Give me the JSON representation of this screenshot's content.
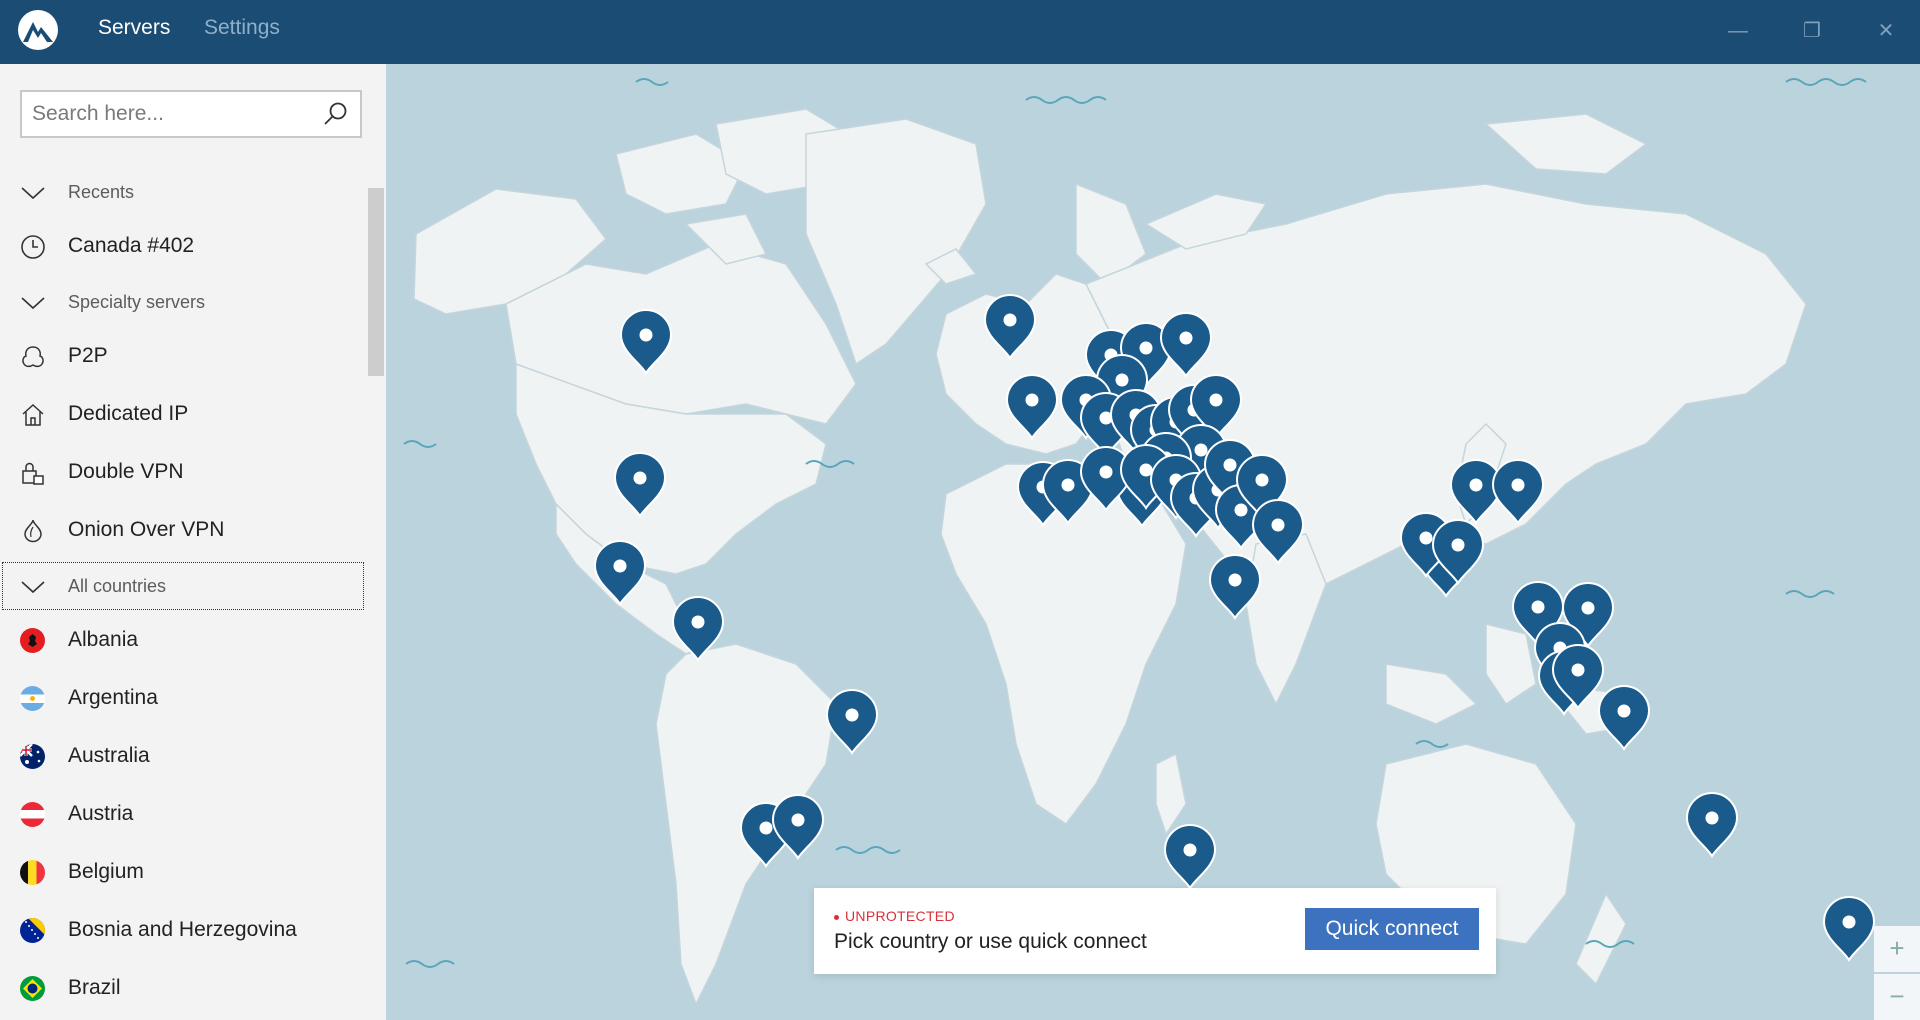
{
  "titlebar": {
    "tabs": [
      {
        "label": "Servers",
        "active": true
      },
      {
        "label": "Settings",
        "active": false
      }
    ],
    "minimize_glyph": "—",
    "restore_glyph": "❐",
    "close_glyph": "✕"
  },
  "search": {
    "placeholder": "Search here..."
  },
  "sidebar": {
    "recents_label": "Recents",
    "recent_item": "Canada #402",
    "specialty_label": "Specialty servers",
    "specialty": [
      {
        "label": "P2P",
        "icon": "p2p-icon"
      },
      {
        "label": "Dedicated IP",
        "icon": "home-icon"
      },
      {
        "label": "Double VPN",
        "icon": "double-lock-icon"
      },
      {
        "label": "Onion Over VPN",
        "icon": "onion-icon"
      }
    ],
    "all_countries_label": "All countries",
    "countries": [
      {
        "label": "Albania",
        "flag": "albania"
      },
      {
        "label": "Argentina",
        "flag": "argentina"
      },
      {
        "label": "Australia",
        "flag": "australia"
      },
      {
        "label": "Austria",
        "flag": "austria"
      },
      {
        "label": "Belgium",
        "flag": "belgium"
      },
      {
        "label": "Bosnia and Herzegovina",
        "flag": "bosnia"
      },
      {
        "label": "Brazil",
        "flag": "brazil"
      }
    ]
  },
  "status": {
    "state": "UNPROTECTED",
    "message": "Pick country or use quick connect",
    "quick_connect_label": "Quick connect"
  },
  "zoom": {
    "in": "+",
    "out": "−"
  },
  "colors": {
    "titlebar": "#1b4c74",
    "pin": "#1b5b8c",
    "ocean": "#bbd3dd",
    "land": "#f0f3f4",
    "accent": "#3c72bf",
    "danger": "#d8313a"
  }
}
